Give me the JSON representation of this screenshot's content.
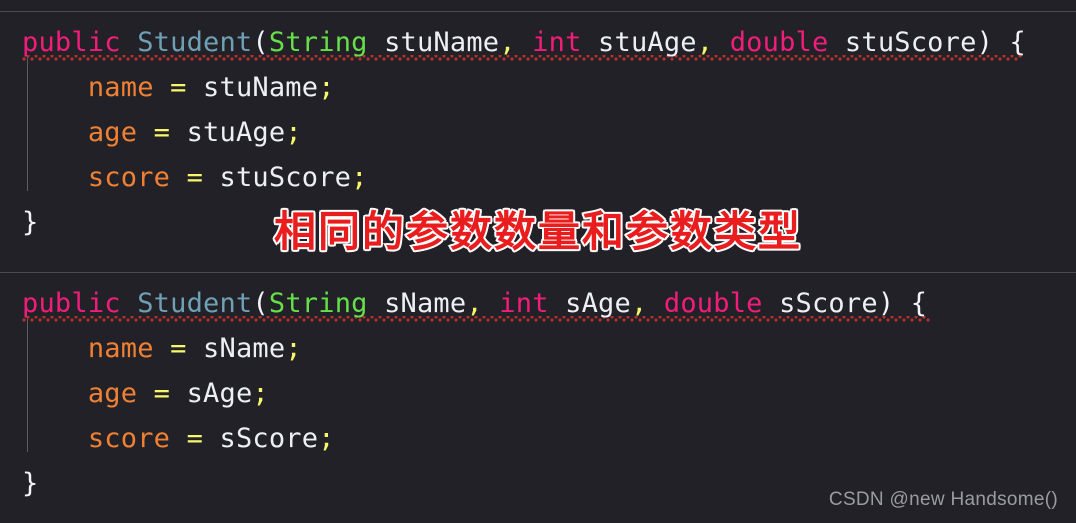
{
  "editor": {
    "background_color": "#212127",
    "separator_color": "#4a4a52",
    "indent_guide_color": "#5b5b63",
    "error_squiggle_color": "#b0302e"
  },
  "syntax_colors": {
    "keyword": "#f21d7a",
    "class_name": "#6fa0b5",
    "string_type": "#66e049",
    "field": "#f08033",
    "variable": "#eceff4",
    "punctuation": "#f2f4f8",
    "operator": "#f7f76a"
  },
  "blocks": [
    {
      "name": "constructor-stu",
      "lines": [
        {
          "tokens": [
            {
              "text": "public",
              "kind": "keyword"
            },
            {
              "text": " ",
              "kind": "plain"
            },
            {
              "text": "Student",
              "kind": "class_name"
            },
            {
              "text": "(",
              "kind": "punctuation"
            },
            {
              "text": "String",
              "kind": "string_type"
            },
            {
              "text": " stuName",
              "kind": "variable"
            },
            {
              "text": ",",
              "kind": "operator"
            },
            {
              "text": " ",
              "kind": "plain"
            },
            {
              "text": "int",
              "kind": "keyword"
            },
            {
              "text": " stuAge",
              "kind": "variable"
            },
            {
              "text": ",",
              "kind": "operator"
            },
            {
              "text": " ",
              "kind": "plain"
            },
            {
              "text": "double",
              "kind": "keyword"
            },
            {
              "text": " stuScore",
              "kind": "variable"
            },
            {
              "text": ") {",
              "kind": "punctuation"
            }
          ]
        },
        {
          "tokens": [
            {
              "text": "    ",
              "kind": "plain"
            },
            {
              "text": "name",
              "kind": "field"
            },
            {
              "text": " = ",
              "kind": "operator"
            },
            {
              "text": "stuName",
              "kind": "variable"
            },
            {
              "text": ";",
              "kind": "operator"
            }
          ]
        },
        {
          "tokens": [
            {
              "text": "    ",
              "kind": "plain"
            },
            {
              "text": "age",
              "kind": "field"
            },
            {
              "text": " = ",
              "kind": "operator"
            },
            {
              "text": "stuAge",
              "kind": "variable"
            },
            {
              "text": ";",
              "kind": "operator"
            }
          ]
        },
        {
          "tokens": [
            {
              "text": "    ",
              "kind": "plain"
            },
            {
              "text": "score",
              "kind": "field"
            },
            {
              "text": " = ",
              "kind": "operator"
            },
            {
              "text": "stuScore",
              "kind": "variable"
            },
            {
              "text": ";",
              "kind": "operator"
            }
          ]
        },
        {
          "tokens": [
            {
              "text": "}",
              "kind": "punctuation"
            }
          ]
        }
      ]
    },
    {
      "name": "constructor-s",
      "lines": [
        {
          "tokens": [
            {
              "text": "public",
              "kind": "keyword"
            },
            {
              "text": " ",
              "kind": "plain"
            },
            {
              "text": "Student",
              "kind": "class_name"
            },
            {
              "text": "(",
              "kind": "punctuation"
            },
            {
              "text": "String",
              "kind": "string_type"
            },
            {
              "text": " sName",
              "kind": "variable"
            },
            {
              "text": ",",
              "kind": "operator"
            },
            {
              "text": " ",
              "kind": "plain"
            },
            {
              "text": "int",
              "kind": "keyword"
            },
            {
              "text": " sAge",
              "kind": "variable"
            },
            {
              "text": ",",
              "kind": "operator"
            },
            {
              "text": " ",
              "kind": "plain"
            },
            {
              "text": "double",
              "kind": "keyword"
            },
            {
              "text": " sScore",
              "kind": "variable"
            },
            {
              "text": ") {",
              "kind": "punctuation"
            }
          ]
        },
        {
          "tokens": [
            {
              "text": "    ",
              "kind": "plain"
            },
            {
              "text": "name",
              "kind": "field"
            },
            {
              "text": " = ",
              "kind": "operator"
            },
            {
              "text": "sName",
              "kind": "variable"
            },
            {
              "text": ";",
              "kind": "operator"
            }
          ]
        },
        {
          "tokens": [
            {
              "text": "    ",
              "kind": "plain"
            },
            {
              "text": "age",
              "kind": "field"
            },
            {
              "text": " = ",
              "kind": "operator"
            },
            {
              "text": "sAge",
              "kind": "variable"
            },
            {
              "text": ";",
              "kind": "operator"
            }
          ]
        },
        {
          "tokens": [
            {
              "text": "    ",
              "kind": "plain"
            },
            {
              "text": "score",
              "kind": "field"
            },
            {
              "text": " = ",
              "kind": "operator"
            },
            {
              "text": "sScore",
              "kind": "variable"
            },
            {
              "text": ";",
              "kind": "operator"
            }
          ]
        },
        {
          "tokens": [
            {
              "text": "}",
              "kind": "punctuation"
            }
          ]
        }
      ]
    }
  ],
  "annotation": {
    "text": "相同的参数数量和参数类型",
    "fill_color": "#e91d1d",
    "outline_color": "#ffffff"
  },
  "watermark": {
    "text": "CSDN @new Handsome()",
    "color": "#9b9ba3"
  }
}
